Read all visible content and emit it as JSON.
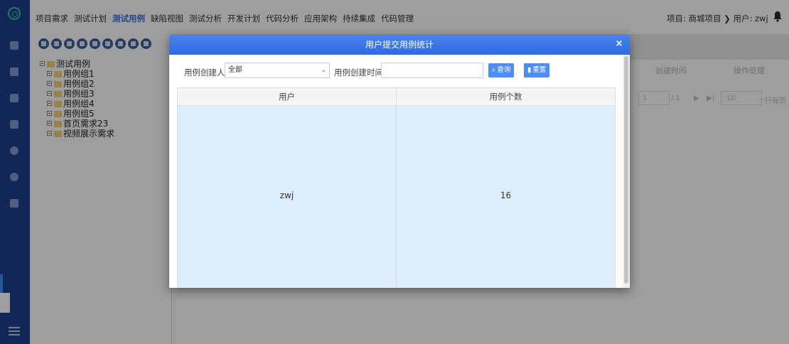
{
  "nav": {
    "items": [
      "项目需求",
      "测试计划",
      "测试用例",
      "缺陷视图",
      "测试分析",
      "开发计划",
      "代码分析",
      "应用架构",
      "持续集成",
      "代码管理"
    ],
    "active_index": 2,
    "project_info": "项目: 商城项目 ❯ 用户: zwj"
  },
  "tree": {
    "root": "测试用例",
    "children": [
      "用例组1",
      "用例组2",
      "用例组3",
      "用例组4",
      "用例组5",
      "首页需求23",
      "视频展示需求"
    ]
  },
  "background": {
    "col_created": "创建时间",
    "col_action": "操作处理",
    "pager_page": "1",
    "pager_total": "/ 1",
    "pager_size": "10",
    "pager_per_page": "行每页"
  },
  "modal": {
    "title": "用户提交用例统计",
    "close_label": "×",
    "creator_label": "用例创建人",
    "creator_value": "全部",
    "created_time_label": "用例创建时间",
    "created_time_value": "",
    "query_label": "查询",
    "reset_label": "重置",
    "columns": [
      "用户",
      "用例个数"
    ],
    "rows": [
      {
        "user": "zwj",
        "count": "16"
      }
    ]
  },
  "colors": {
    "sidebar": "#1d3f8a",
    "accent": "#3a73e0",
    "modal_header": "#3a78e6",
    "row_bg": "#deeefa"
  }
}
